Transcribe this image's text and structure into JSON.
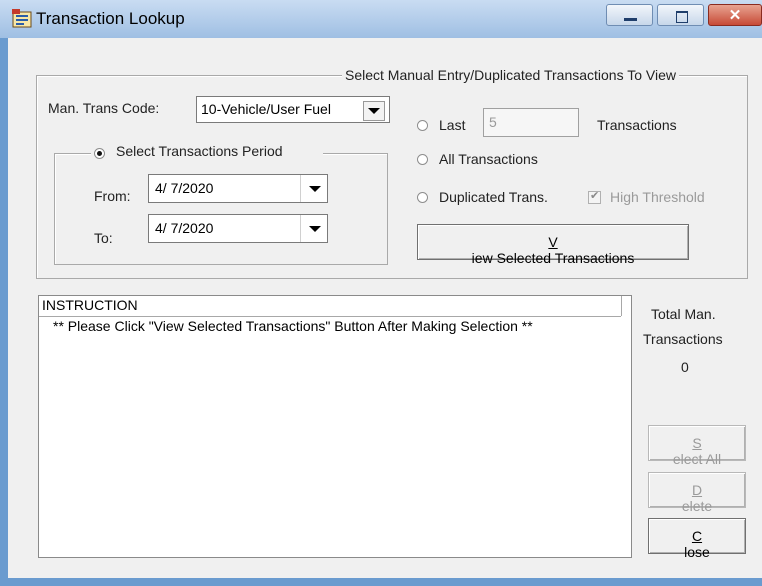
{
  "window": {
    "title": "Transaction Lookup"
  },
  "selection_group": {
    "legend": "Select Manual Entry/Duplicated Transactions To View",
    "trans_code_label": "Man. Trans Code:",
    "trans_code_value": "10-Vehicle/User Fuel",
    "period": {
      "legend": "Select Transactions Period",
      "from_label": "From:",
      "from_value": "4/ 7/2020",
      "to_label": "To:",
      "to_value": "4/ 7/2020"
    },
    "last": {
      "label": "Last",
      "value": "5",
      "suffix": "Transactions"
    },
    "all_label": "All Transactions",
    "duplicated_label": "Duplicated Trans.",
    "high_threshold_label": "High Threshold",
    "view_button": {
      "mnemonic": "V",
      "rest": "iew Selected Transactions"
    }
  },
  "instruction_list": {
    "header": "INSTRUCTION",
    "rows": [
      "** Please Click \"View Selected Transactions\" Button After Making Selection **"
    ]
  },
  "totals": {
    "line1": "Total Man.",
    "line2": "Transactions",
    "count": "0"
  },
  "buttons": {
    "select_all": {
      "mnemonic": "S",
      "rest": "elect All"
    },
    "delete": {
      "mnemonic": "D",
      "rest": "elete"
    },
    "close": {
      "mnemonic": "C",
      "rest": "lose"
    }
  }
}
